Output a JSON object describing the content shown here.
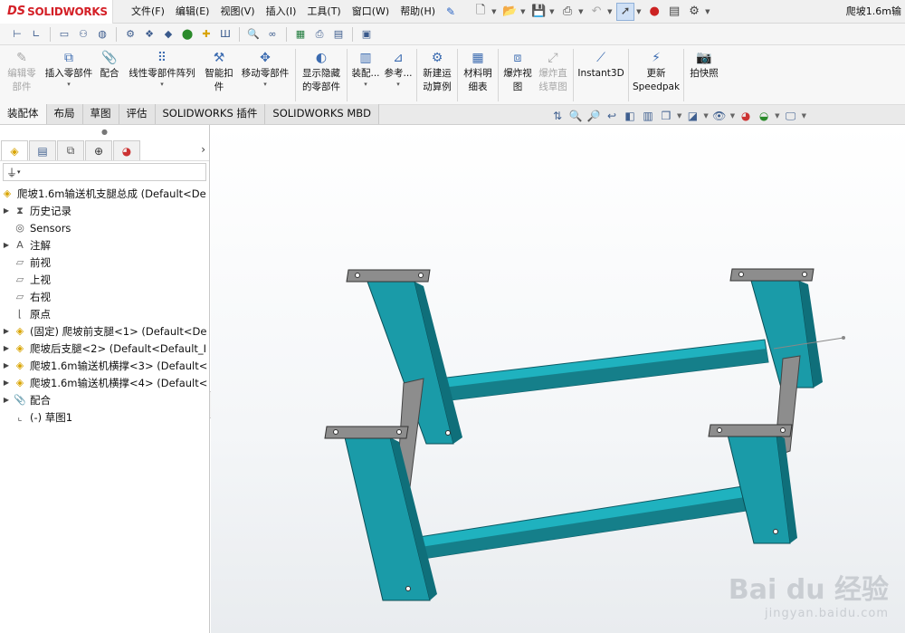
{
  "app": {
    "brand_prefix": "DS",
    "brand": "SOLIDWORKS",
    "doc_title": "爬坡1.6m输"
  },
  "menu": [
    "文件(F)",
    "编辑(E)",
    "视图(V)",
    "插入(I)",
    "工具(T)",
    "窗口(W)",
    "帮助(H)"
  ],
  "commands": [
    {
      "label": "编辑零\n部件",
      "disabled": true
    },
    {
      "label": "插入零部件",
      "disabled": false
    },
    {
      "label": "配合",
      "disabled": false
    },
    {
      "label": "线性零部件阵列",
      "disabled": false
    },
    {
      "label": "智能扣\n件",
      "disabled": false
    },
    {
      "label": "移动零部件",
      "disabled": false
    },
    {
      "label": "显示隐藏\n的零部件",
      "disabled": false
    },
    {
      "label": "装配...",
      "disabled": false
    },
    {
      "label": "参考...",
      "disabled": false
    },
    {
      "label": "新建运\n动算例",
      "disabled": false
    },
    {
      "label": "材料明\n细表",
      "disabled": false
    },
    {
      "label": "爆炸视\n图",
      "disabled": false
    },
    {
      "label": "爆炸直\n线草图",
      "disabled": true
    },
    {
      "label": "Instant3D",
      "disabled": false
    },
    {
      "label": "更新\nSpeedpak",
      "disabled": false
    },
    {
      "label": "拍快照",
      "disabled": false
    }
  ],
  "tabs": [
    "装配体",
    "布局",
    "草图",
    "评估",
    "SOLIDWORKS 插件",
    "SOLIDWORKS MBD"
  ],
  "tree": {
    "root": "爬坡1.6m输送机支腿总成  (Default<De",
    "items": [
      {
        "label": "历史记录",
        "expand": true,
        "icon": "history-icon"
      },
      {
        "label": "Sensors",
        "expand": false,
        "icon": "sensor-icon"
      },
      {
        "label": "注解",
        "expand": true,
        "icon": "annotation-icon"
      },
      {
        "label": "前视",
        "expand": false,
        "icon": "plane-icon"
      },
      {
        "label": "上视",
        "expand": false,
        "icon": "plane-icon"
      },
      {
        "label": "右视",
        "expand": false,
        "icon": "plane-icon"
      },
      {
        "label": "原点",
        "expand": false,
        "icon": "origin-icon"
      },
      {
        "label": "(固定) 爬坡前支腿<1> (Default<De",
        "expand": true,
        "icon": "assembly-icon"
      },
      {
        "label": "爬坡后支腿<2> (Default<Default_I",
        "expand": true,
        "icon": "assembly-icon"
      },
      {
        "label": "爬坡1.6m输送机横撑<3> (Default<",
        "expand": true,
        "icon": "assembly-icon"
      },
      {
        "label": "爬坡1.6m输送机横撑<4> (Default<",
        "expand": true,
        "icon": "assembly-icon"
      },
      {
        "label": "配合",
        "expand": true,
        "icon": "mate-icon"
      },
      {
        "label": "(-) 草图1",
        "expand": false,
        "icon": "sketch-icon"
      }
    ]
  },
  "watermark": {
    "line1": "Bai du 经验",
    "line2": "jingyan.baidu.com"
  },
  "colors": {
    "beam": "#1a9ba8",
    "beam_dark": "#0f6f7a",
    "plate": "#8d8d8d",
    "brand_red": "#d42027"
  }
}
